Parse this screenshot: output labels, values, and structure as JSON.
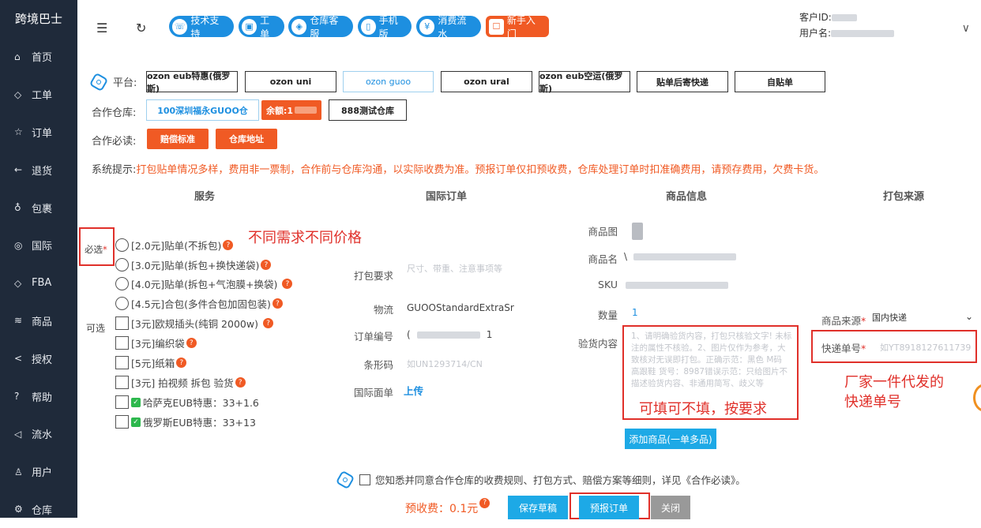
{
  "sidebar": {
    "brand": "跨境巴士",
    "items": [
      {
        "icon": "home-icon",
        "glyph": "⌂",
        "label": "首页"
      },
      {
        "icon": "diamond-icon",
        "glyph": "◇",
        "label": "工单"
      },
      {
        "icon": "star-icon",
        "glyph": "☆",
        "label": "订单"
      },
      {
        "icon": "arrow-left-icon",
        "glyph": "←",
        "label": "退货"
      },
      {
        "icon": "package-icon",
        "glyph": "♁",
        "label": "包裹"
      },
      {
        "icon": "eye-icon",
        "glyph": "◎",
        "label": "国际"
      },
      {
        "icon": "diamond-icon",
        "glyph": "◇",
        "label": "FBA"
      },
      {
        "icon": "layers-icon",
        "glyph": "≋",
        "label": "商品"
      },
      {
        "icon": "share-icon",
        "glyph": "<",
        "label": "授权"
      },
      {
        "icon": "help-icon",
        "glyph": "?",
        "label": "帮助"
      },
      {
        "icon": "send-icon",
        "glyph": "◁",
        "label": "流水"
      },
      {
        "icon": "user-icon",
        "glyph": "♙",
        "label": "用户"
      },
      {
        "icon": "gear-icon",
        "glyph": "⚙",
        "label": "仓库"
      }
    ]
  },
  "topbar": {
    "buttons": [
      {
        "label": "技术支持",
        "glyph": "☏"
      },
      {
        "label": "工单",
        "glyph": "▣"
      },
      {
        "label": "仓库客服",
        "glyph": "◈"
      },
      {
        "label": "手机版",
        "glyph": "▯"
      },
      {
        "label": "消费流水",
        "glyph": "¥"
      },
      {
        "label": "新手入门",
        "glyph": "☐"
      }
    ],
    "customer_id_label": "客户ID:",
    "username_label": "用户名:"
  },
  "platform": {
    "label": "平台:",
    "options": [
      "ozon eub特惠(俄罗斯)",
      "ozon uni",
      "ozon guoo",
      "ozon ural",
      "ozon eub空运(俄罗斯)",
      "贴单后寄快递",
      "自贴单"
    ],
    "selected": "ozon guoo"
  },
  "warehouse": {
    "label": "合作仓库:",
    "selected": "100深圳福永GUOO仓",
    "balance": "余额:1",
    "other": "888测试仓库"
  },
  "must_read": {
    "label": "合作必读:",
    "buttons": [
      "赔偿标准",
      "仓库地址"
    ]
  },
  "system_tip": {
    "label": "系统提示:",
    "text": "打包贴单情况多样，费用非一票制，合作前与仓库沟通，以实际收费为准。预报订单仅扣预收费，仓库处理订单时扣准确费用，请预存费用，欠费卡货。"
  },
  "columns": [
    "服务",
    "国际订单",
    "商品信息",
    "打包来源"
  ],
  "services": {
    "required_label": "必选",
    "required_star": "*",
    "optional_label": "可选",
    "annotation": "不同需求不同价格",
    "required": [
      "[2.0元]贴单(不拆包)",
      "[3.0元]贴单(拆包+换快递袋)",
      "[4.0元]贴单(拆包+气泡膜+换袋)",
      "[4.5元]合包(多件合包加固包装)"
    ],
    "optional": [
      "[3元]欧规插头(纯铜 2000w)",
      "[3元]编织袋",
      "[5元]纸箱",
      "[3元] 拍视频 拆包 验货"
    ],
    "optional_checked": [
      "哈萨克EUB特惠：33+1.6",
      "俄罗斯EUB特惠：33+13"
    ]
  },
  "intl_order": {
    "pack_req_label": "打包要求",
    "pack_req_placeholder": "尺寸、带重、注意事项等",
    "logistics_label": "物流",
    "logistics_value": "GUOOStandardExtraSr",
    "order_no_label": "订单编号",
    "order_no_value": "(",
    "order_no_tail": "1",
    "barcode_label": "条形码",
    "barcode_value": "如UN1293714/CN",
    "intl_sheet_label": "国际面单",
    "upload_label": "上传"
  },
  "product": {
    "image_label": "商品图",
    "name_label": "商品名",
    "name_value": "\\",
    "sku_label": "SKU",
    "qty_label": "数量",
    "qty_value": "1",
    "inspect_label": "验货内容",
    "inspect_placeholder": "1、请明确验货内容，打包只核验文字! 未标注的属性不核验。2、图片仅作为参考，大致核对无误即打包。正确示范：黑色 M码 高跟鞋 货号：8987错误示范：只给图片不描述验货内容、非通用简写、歧义等",
    "inspect_annotation": "可填可不填，按要求",
    "add_button": "添加商品(一单多品)"
  },
  "pack_source": {
    "source_label": "商品来源",
    "source_value": "国内快递",
    "tracking_label": "快递单号",
    "tracking_placeholder": "如YT8918127611739",
    "annotation_line1": "厂家一件代发的",
    "annotation_line2": "快递单号"
  },
  "footer": {
    "agree_text": "您知悉并同意合作仓库的收费规则、打包方式、赔偿方案等细则，详见《合作必读》。",
    "prefee": "预收费：0.1元",
    "save_draft": "保存草稿",
    "submit": "预报订单",
    "close": "关闭"
  },
  "colors": {
    "sidebar": "#1f2a3a",
    "primary": "#1d8fe0",
    "accent": "#f05a24",
    "annotation": "#e0302a"
  }
}
